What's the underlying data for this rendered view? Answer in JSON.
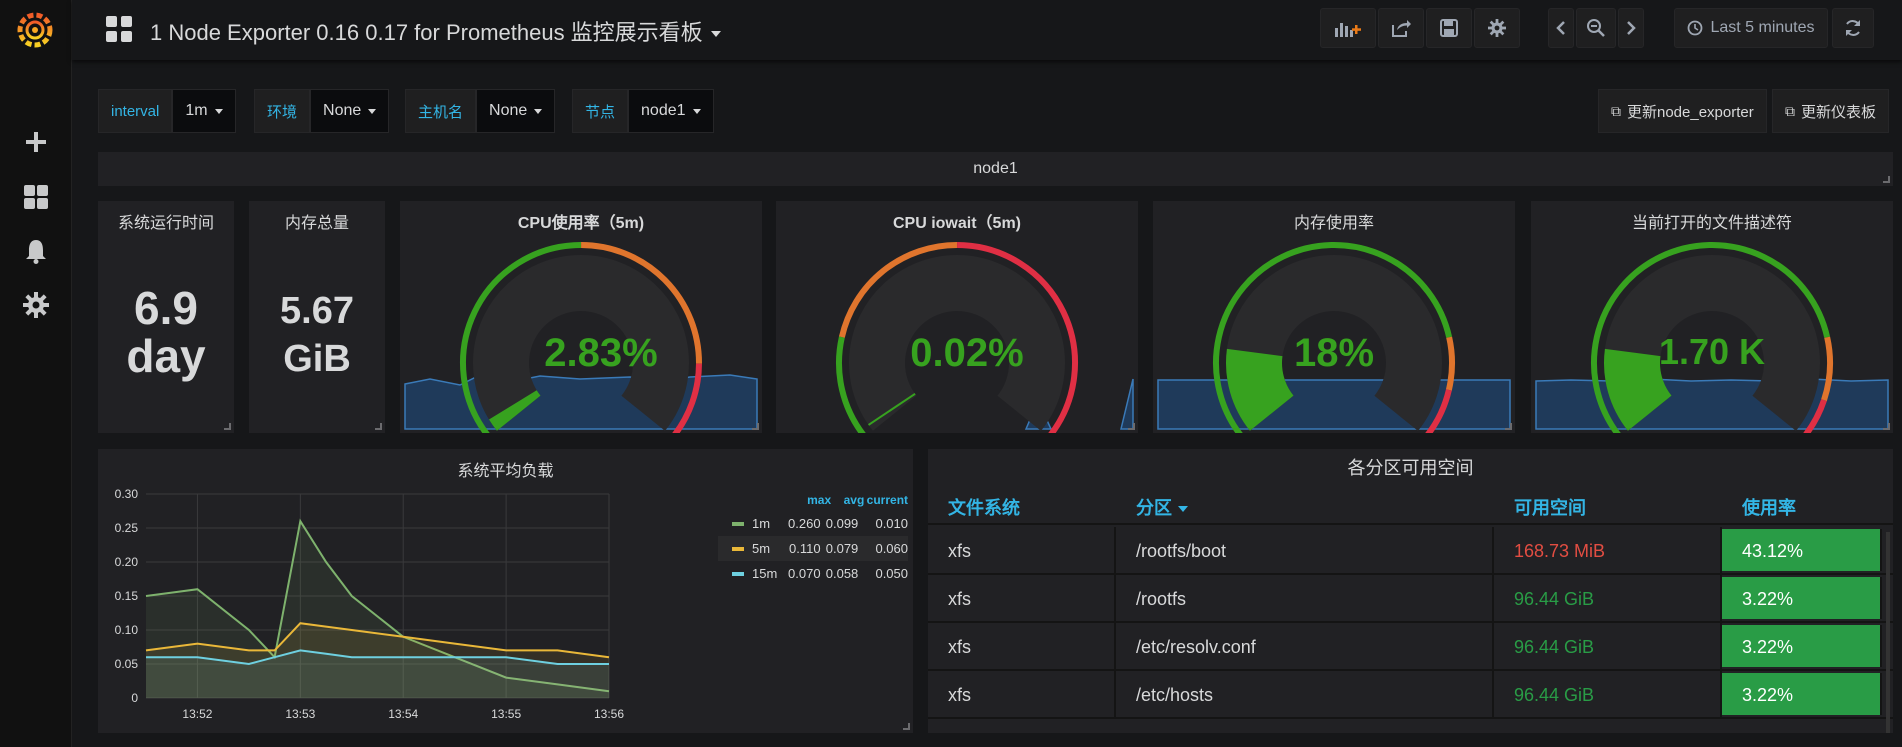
{
  "dashboard": {
    "title": "1 Node Exporter 0.16 0.17 for Prometheus 监控展示看板",
    "time_range": "Last 5 minutes"
  },
  "variables": [
    {
      "label": "interval",
      "value": "1m"
    },
    {
      "label": "环境",
      "value": "None"
    },
    {
      "label": "主机名",
      "value": "None"
    },
    {
      "label": "节点",
      "value": "node1"
    }
  ],
  "links": {
    "update_exporter": "更新node_exporter",
    "update_dashboard": "更新仪表板"
  },
  "row": {
    "title": "node1"
  },
  "panels": {
    "uptime": {
      "title": "系统运行时间",
      "value_line1": "6.9",
      "value_line2": "day"
    },
    "mem_total": {
      "title": "内存总量",
      "value_line1": "5.67",
      "value_line2": "GiB"
    },
    "cpu": {
      "title": "CPU使用率（5m)",
      "value": "2.83%",
      "level": 0.0283
    },
    "iowait": {
      "title": "CPU iowait（5m)",
      "value": "0.02%",
      "level": 0.0002
    },
    "mem_usage": {
      "title": "内存使用率",
      "value": "18%",
      "level": 0.18
    },
    "fd": {
      "title": "当前打开的文件描述符",
      "value": "1.70 K",
      "level": 0.18
    }
  },
  "load_panel": {
    "title": "系统平均负载",
    "legend_headers": {
      "max": "max",
      "avg": "avg",
      "current": "current"
    },
    "legend": [
      {
        "name": "1m",
        "color": "#7eb26d",
        "max": "0.260",
        "avg": "0.099",
        "current": "0.010"
      },
      {
        "name": "5m",
        "color": "#eab839",
        "max": "0.110",
        "avg": "0.079",
        "current": "0.060"
      },
      {
        "name": "15m",
        "color": "#6ed0e0",
        "max": "0.070",
        "avg": "0.058",
        "current": "0.050"
      }
    ],
    "y_ticks": [
      "0.30",
      "0.25",
      "0.20",
      "0.15",
      "0.10",
      "0.05",
      "0"
    ],
    "x_ticks": [
      "13:52",
      "13:53",
      "13:54",
      "13:55",
      "13:56"
    ]
  },
  "chart_data": {
    "type": "line",
    "title": "系统平均负载",
    "x": [
      "13:51:30",
      "13:51:45",
      "13:52:00",
      "13:52:30",
      "13:52:45",
      "13:53:00",
      "13:53:15",
      "13:53:30",
      "13:54:00",
      "13:54:30",
      "13:55:00",
      "13:55:30",
      "13:56:00"
    ],
    "ylim": [
      0,
      0.3
    ],
    "series": [
      {
        "name": "1m",
        "values": [
          0.15,
          0.155,
          0.16,
          0.1,
          0.06,
          0.26,
          0.2,
          0.15,
          0.09,
          0.06,
          0.03,
          0.02,
          0.01
        ]
      },
      {
        "name": "5m",
        "values": [
          0.07,
          0.075,
          0.08,
          0.07,
          0.07,
          0.11,
          0.105,
          0.1,
          0.09,
          0.08,
          0.07,
          0.07,
          0.06
        ]
      },
      {
        "name": "15m",
        "values": [
          0.06,
          0.06,
          0.06,
          0.05,
          0.06,
          0.07,
          0.065,
          0.06,
          0.06,
          0.06,
          0.06,
          0.05,
          0.05
        ]
      }
    ]
  },
  "fs_panel": {
    "title": "各分区可用空间",
    "columns": [
      "文件系统",
      "分区",
      "可用空间",
      "使用率"
    ],
    "rows": [
      {
        "fs": "xfs",
        "mount": "/rootfs/boot",
        "avail": "168.73 MiB",
        "usage": "43.12%",
        "avail_color": "#e24d42"
      },
      {
        "fs": "xfs",
        "mount": "/rootfs",
        "avail": "96.44 GiB",
        "usage": "3.22%",
        "avail_color": "#299c46"
      },
      {
        "fs": "xfs",
        "mount": "/etc/resolv.conf",
        "avail": "96.44 GiB",
        "usage": "3.22%",
        "avail_color": "#299c46"
      },
      {
        "fs": "xfs",
        "mount": "/etc/hosts",
        "avail": "96.44 GiB",
        "usage": "3.22%",
        "avail_color": "#299c46"
      }
    ]
  },
  "colors": {
    "green": "#37a21f",
    "orange": "#e0752d",
    "red": "#e02f44",
    "blue": "#33b5e5"
  }
}
